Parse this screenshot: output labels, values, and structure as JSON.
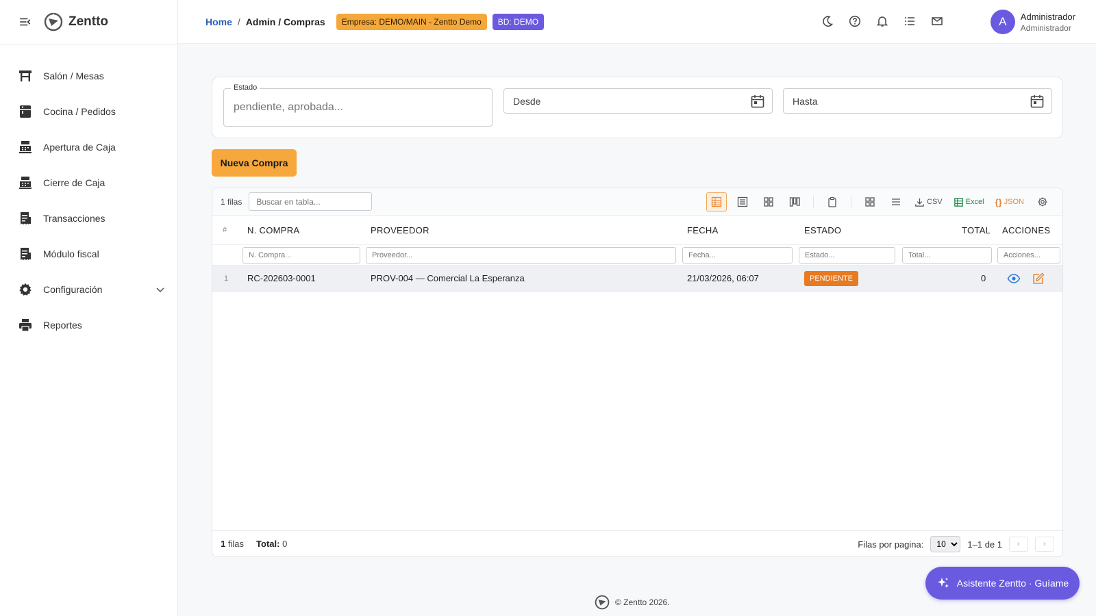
{
  "app": {
    "brand": "Zentto",
    "footer": "© Zentto 2026."
  },
  "sidebar": {
    "items": [
      {
        "label": "Salón / Mesas",
        "icon": "table-icon"
      },
      {
        "label": "Cocina / Pedidos",
        "icon": "kitchen-icon"
      },
      {
        "label": "Apertura de Caja",
        "icon": "cash-register-icon"
      },
      {
        "label": "Cierre de Caja",
        "icon": "cash-register-icon"
      },
      {
        "label": "Transacciones",
        "icon": "receipt-icon"
      },
      {
        "label": "Módulo fiscal",
        "icon": "receipt-icon"
      },
      {
        "label": "Configuración",
        "icon": "gear-icon"
      },
      {
        "label": "Reportes",
        "icon": "printer-icon"
      }
    ]
  },
  "header": {
    "breadcrumb": {
      "home": "Home",
      "sep": "/",
      "current": "Admin / Compras"
    },
    "empresa_badge": "Empresa: DEMO/MAIN - Zentto Demo",
    "bd_badge": "BD: DEMO",
    "user": {
      "initial": "A",
      "name": "Administrador",
      "role": "Administrador"
    }
  },
  "filters": {
    "estado_label": "Estado",
    "estado_placeholder": "pendiente, aprobada...",
    "desde_label": "Desde",
    "hasta_label": "Hasta"
  },
  "actions": {
    "nueva_compra": "Nueva Compra"
  },
  "table": {
    "rows_label": "1 filas",
    "search_placeholder": "Buscar en tabla...",
    "export": {
      "csv": "CSV",
      "excel": "Excel",
      "json": "JSON"
    },
    "columns": {
      "idx": "#",
      "compra": "N. COMPRA",
      "proveedor": "PROVEEDOR",
      "fecha": "FECHA",
      "estado": "ESTADO",
      "total": "TOTAL",
      "acciones": "ACCIONES"
    },
    "filter_placeholders": {
      "compra": "N. Compra...",
      "proveedor": "Proveedor...",
      "fecha": "Fecha...",
      "estado": "Estado...",
      "total": "Total...",
      "acciones": "Acciones..."
    },
    "rows": [
      {
        "idx": "1",
        "compra": "RC-202603-0001",
        "proveedor": "PROV-004 — Comercial La Esperanza",
        "fecha": "21/03/2026, 06:07",
        "estado": "PENDIENTE",
        "total": "0"
      }
    ],
    "footer": {
      "count": "1",
      "filas": "filas",
      "total_label": "Total:",
      "total_value": "0",
      "per_page_label": "Filas por pagina:",
      "per_page_value": "10",
      "range": "1–1 de 1",
      "prev": "‹",
      "next": "›"
    }
  },
  "assistant": {
    "label": "Asistente Zentto · Guíame"
  },
  "colors": {
    "accent": "#6a5ae0",
    "orange": "#f7a83c",
    "link": "#2b5fb8",
    "pending": "#e87a1f"
  }
}
